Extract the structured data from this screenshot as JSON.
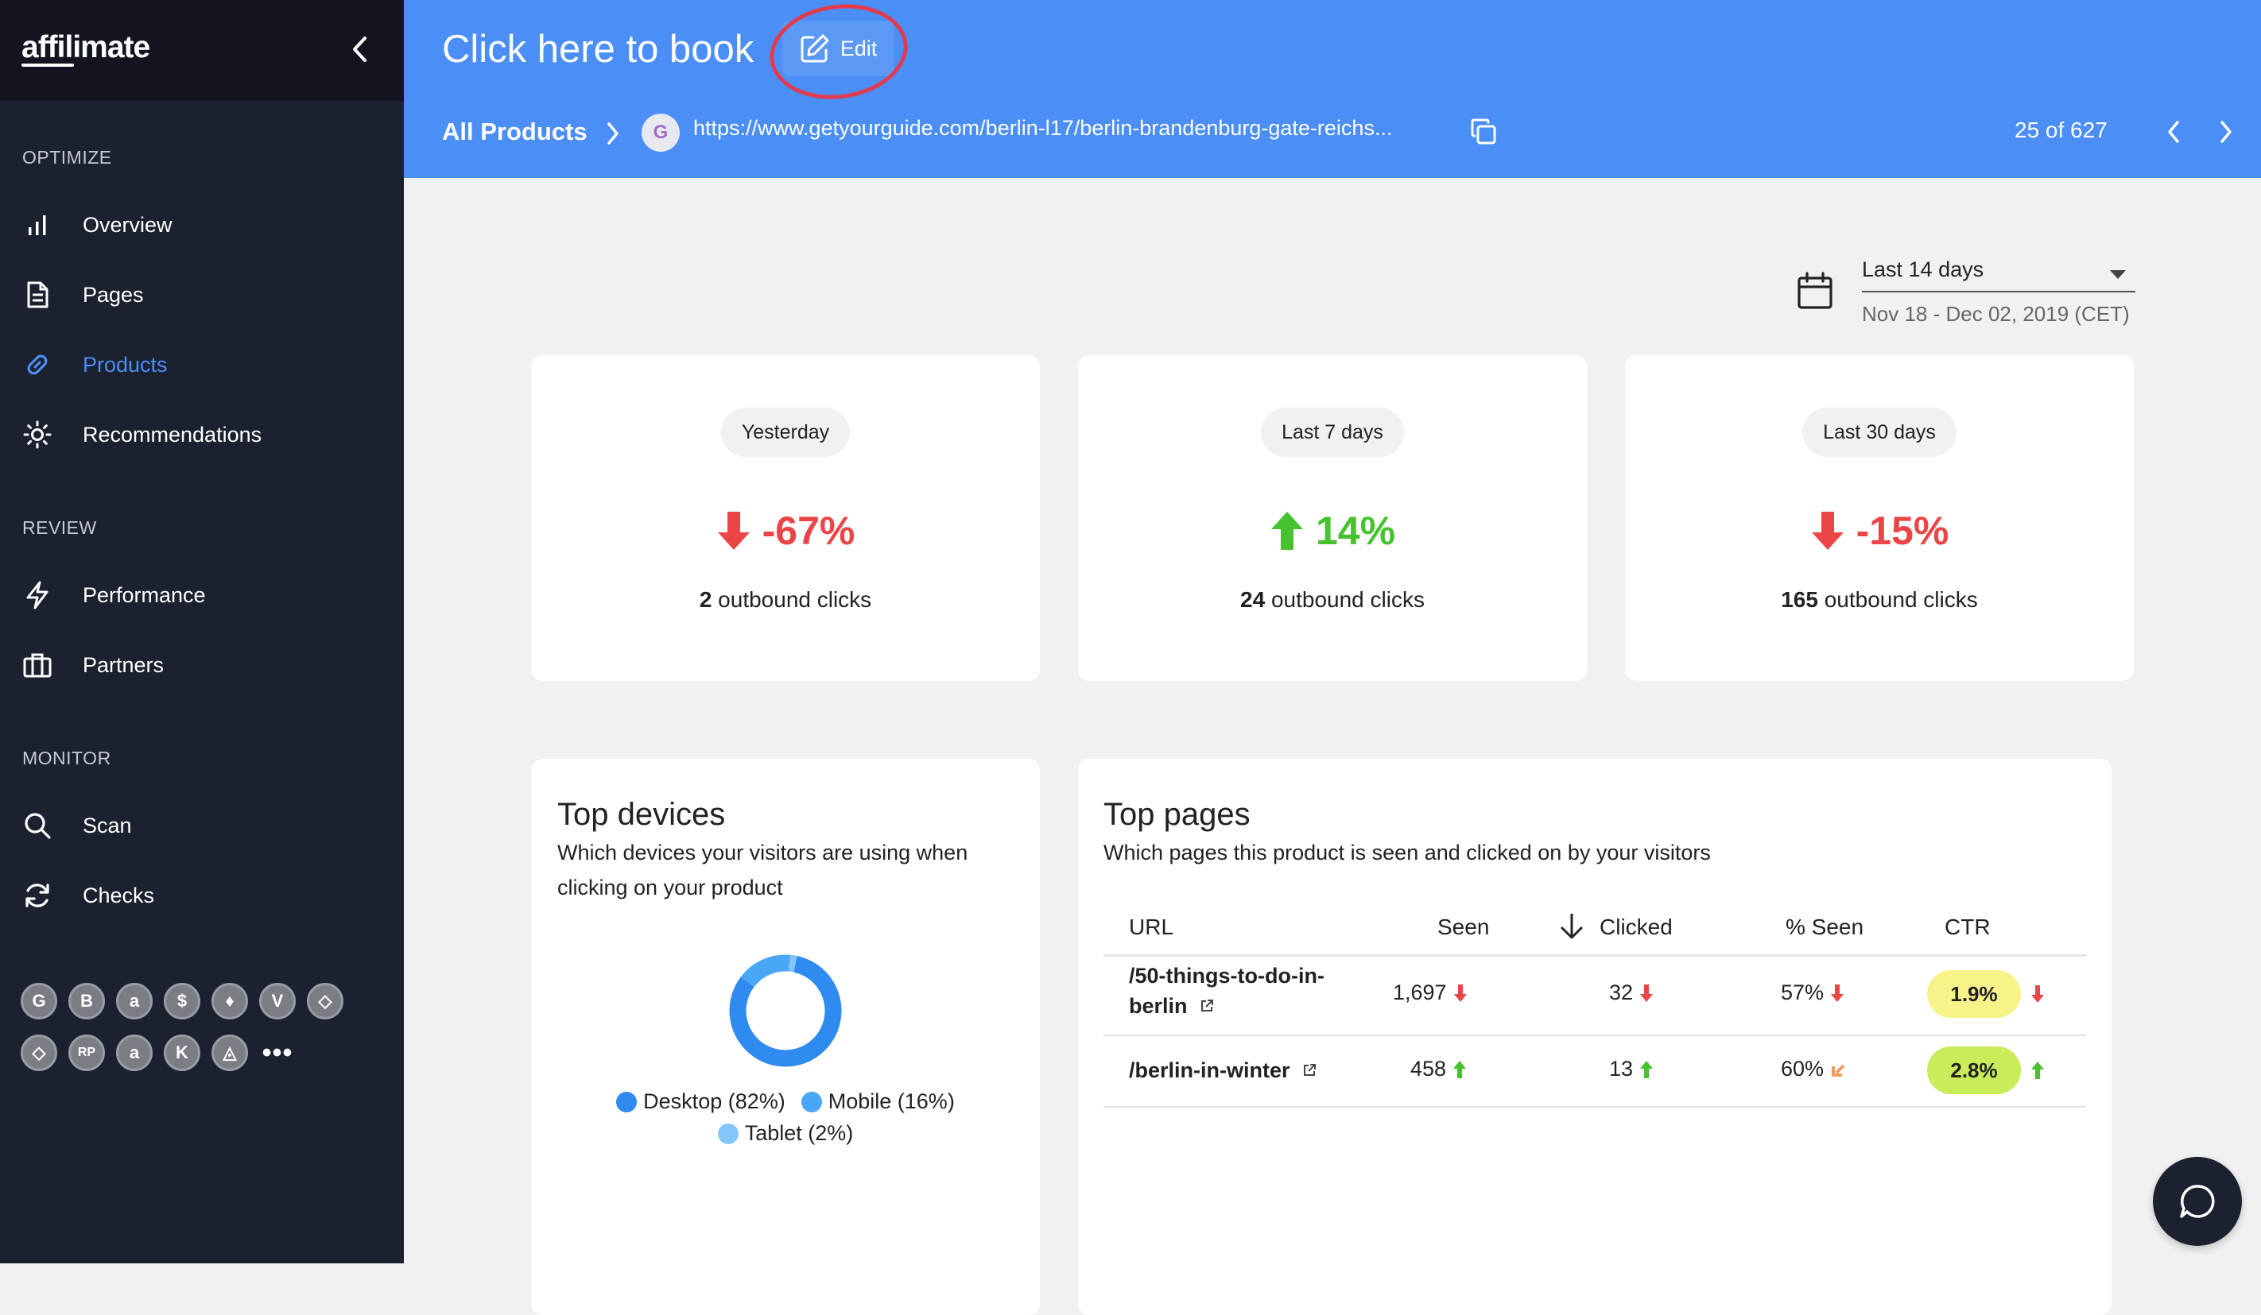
{
  "sidebar": {
    "logo": "affilimate",
    "sections": [
      {
        "label": "OPTIMIZE",
        "items": [
          {
            "label": "Overview",
            "icon": "bar-chart-icon"
          },
          {
            "label": "Pages",
            "icon": "document-icon"
          },
          {
            "label": "Products",
            "icon": "link-icon",
            "active": true
          },
          {
            "label": "Recommendations",
            "icon": "sun-icon"
          }
        ]
      },
      {
        "label": "REVIEW",
        "items": [
          {
            "label": "Performance",
            "icon": "lightning-icon"
          },
          {
            "label": "Partners",
            "icon": "briefcase-icon"
          }
        ]
      },
      {
        "label": "MONITOR",
        "items": [
          {
            "label": "Scan",
            "icon": "search-icon"
          },
          {
            "label": "Checks",
            "icon": "refresh-icon"
          }
        ]
      }
    ],
    "partners_row1": [
      "G",
      "B",
      "a",
      "$",
      "♦",
      "V",
      "◇"
    ],
    "partners_row2": [
      "◇",
      "RP",
      "a",
      "K",
      "◬"
    ],
    "more": "•••"
  },
  "header": {
    "title": "Click here to book",
    "edit_label": "Edit",
    "breadcrumb": "All Products",
    "favicon_letter": "G",
    "url": "https://www.getyourguide.com/berlin-l17/berlin-brandenburg-gate-reichs...",
    "pager": "25 of 627"
  },
  "date_range": {
    "selected": "Last 14 days",
    "subtitle": "Nov 18 - Dec 02, 2019 (CET)"
  },
  "stats": [
    {
      "period": "Yesterday",
      "change": "-67%",
      "direction": "down",
      "count": "2",
      "count_label": "outbound clicks"
    },
    {
      "period": "Last 7 days",
      "change": "14%",
      "direction": "up",
      "count": "24",
      "count_label": "outbound clicks"
    },
    {
      "period": "Last 30 days",
      "change": "-15%",
      "direction": "down",
      "count": "165",
      "count_label": "outbound clicks"
    }
  ],
  "top_devices": {
    "title": "Top devices",
    "desc_line1": "Which devices your visitors are using when",
    "desc_line2": "clicking on your product",
    "segments": [
      {
        "label": "Desktop (82%)",
        "value": 82,
        "color": "#2f8bef"
      },
      {
        "label": "Mobile (16%)",
        "value": 16,
        "color": "#4aa6f6"
      },
      {
        "label": "Tablet (2%)",
        "value": 2,
        "color": "#84c6fa"
      }
    ]
  },
  "top_pages": {
    "title": "Top pages",
    "desc": "Which pages this product is seen and clicked on by your visitors",
    "columns": {
      "url": "URL",
      "seen": "Seen",
      "clicked": "Clicked",
      "pct_seen": "% Seen",
      "ctr": "CTR"
    },
    "rows": [
      {
        "url_line1": "/50-things-to-do-in-",
        "url_line2": "berlin",
        "seen": "1,697",
        "seen_dir": "down",
        "clicked": "32",
        "clicked_dir": "down",
        "pct_seen": "57%",
        "pct_dir": "down",
        "ctr": "1.9%",
        "ctr_dir": "down",
        "ctr_color": "#f7f38a"
      },
      {
        "url_line1": "/berlin-in-winter",
        "url_line2": "",
        "seen": "458",
        "seen_dir": "up",
        "clicked": "13",
        "clicked_dir": "up",
        "pct_seen": "60%",
        "pct_dir": "down-left",
        "ctr": "2.8%",
        "ctr_dir": "up",
        "ctr_color": "#c8ec5a"
      }
    ]
  },
  "colors": {
    "sidebar_bg": "#1c2130",
    "accent": "#4b8ef5",
    "down": "#ec4548",
    "up": "#45c22e"
  }
}
